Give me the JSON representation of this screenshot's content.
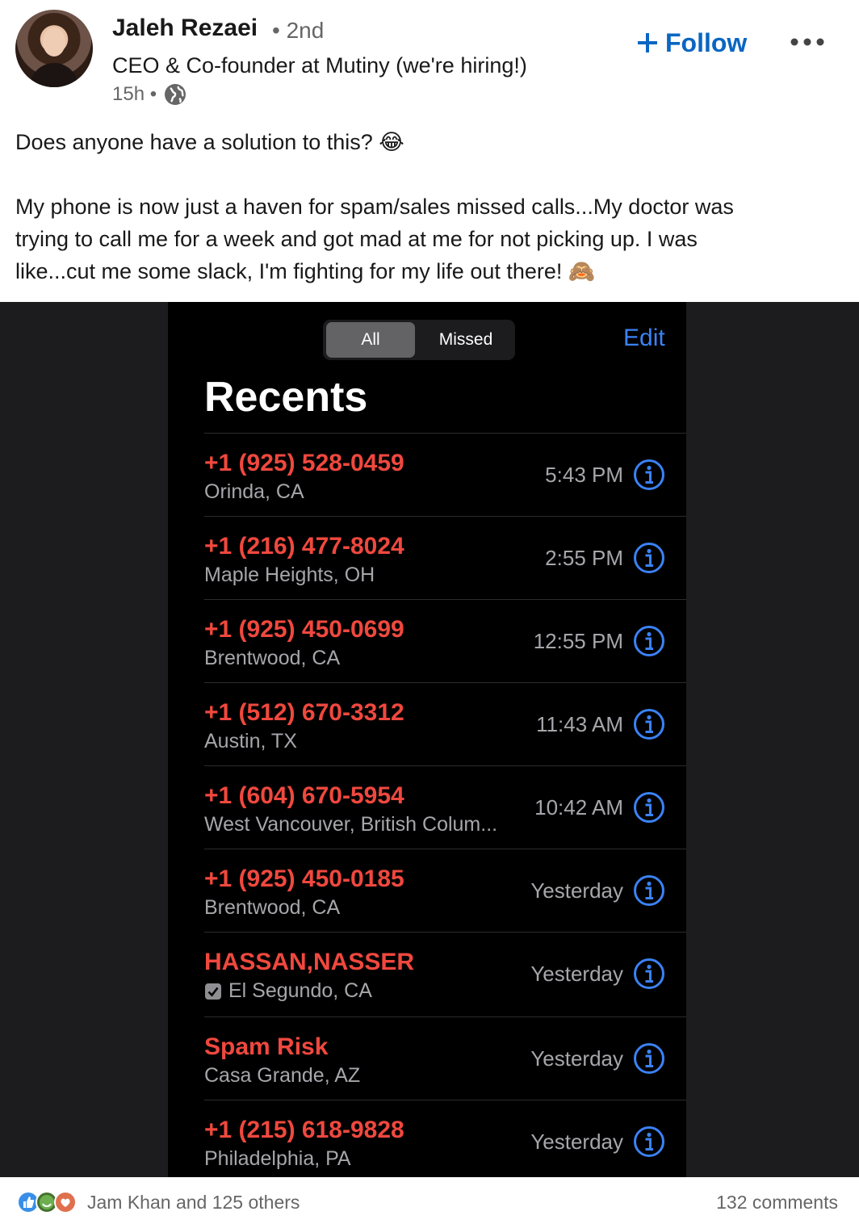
{
  "post": {
    "author_name": "Jaleh Rezaei",
    "degree": "• 2nd",
    "headline": "CEO & Co-founder at Mutiny (we're hiring!)",
    "time": "15h •",
    "follow_label": "Follow",
    "text_line1": "Does anyone have a solution to this? 😂",
    "text_line2": "My phone is now just a haven for spam/sales missed calls...My doctor was",
    "text_line3": "trying to call me for a week and got mad at me for not picking up. I was",
    "text_line4": "like...cut me some slack, I'm fighting for my life out there! 🙈"
  },
  "phone": {
    "segment_all": "All",
    "segment_missed": "Missed",
    "edit_label": "Edit",
    "title": "Recents",
    "calls": [
      {
        "name": "+1 (925) 528-0459",
        "location": "Orinda, CA",
        "time": "5:43 PM"
      },
      {
        "name": "+1 (216) 477-8024",
        "location": "Maple Heights, OH",
        "time": "2:55 PM"
      },
      {
        "name": "+1 (925) 450-0699",
        "location": "Brentwood, CA",
        "time": "12:55 PM"
      },
      {
        "name": "+1 (512) 670-3312",
        "location": "Austin, TX",
        "time": "11:43 AM"
      },
      {
        "name": "+1 (604) 670-5954",
        "location": "West Vancouver, British Colum...",
        "time": "10:42 AM"
      },
      {
        "name": "+1 (925) 450-0185",
        "location": "Brentwood, CA",
        "time": "Yesterday"
      },
      {
        "name": "HASSAN,NASSER",
        "location": "El Segundo, CA",
        "time": "Yesterday"
      },
      {
        "name": "Spam Risk",
        "location": "Casa Grande, AZ",
        "time": "Yesterday"
      },
      {
        "name": "+1 (215) 618-9828",
        "location": "Philadelphia, PA",
        "time": "Yesterday"
      }
    ]
  },
  "social": {
    "reactions_text": "Jam Khan and 125 others",
    "comments": "132 comments"
  },
  "colors": {
    "linkedin_blue": "#0a66c2",
    "missed_call_red": "#f0483e",
    "ios_blue": "#3b82f6"
  },
  "icons": [
    "globe-icon",
    "plus-icon",
    "more-icon",
    "info-icon",
    "check-icon",
    "like-reaction-icon",
    "celebrate-reaction-icon",
    "love-reaction-icon"
  ]
}
